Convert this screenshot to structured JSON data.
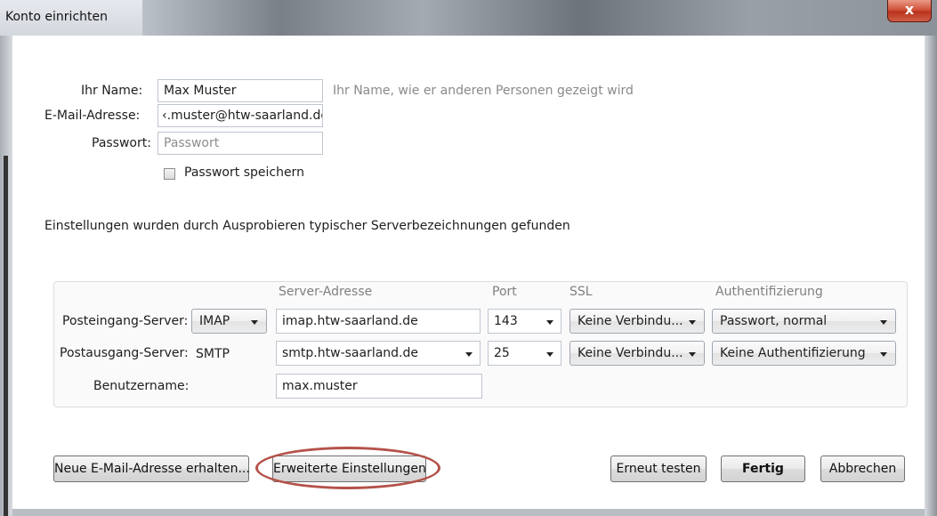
{
  "window": {
    "title": "Konto einrichten",
    "close_glyph": "x"
  },
  "account": {
    "name_label": "Ihr Name:",
    "name_value": "Max Muster",
    "name_hint": "Ihr Name, wie er anderen Personen gezeigt wird",
    "email_label": "E-Mail-Adresse:",
    "email_value": "‹.muster@htw-saarland.de",
    "password_label": "Passwort:",
    "password_placeholder": "Passwort",
    "save_password_label": "Passwort speichern",
    "save_password_checked": false
  },
  "status_message": "Einstellungen wurden durch Ausprobieren typischer Serverbezeichnungen gefunden",
  "server": {
    "columns": {
      "address": "Server-Adresse",
      "port": "Port",
      "ssl": "SSL",
      "auth": "Authentifizierung"
    },
    "incoming": {
      "label": "Posteingang-Server:",
      "protocol": "IMAP",
      "address": "imap.htw-saarland.de",
      "port": "143",
      "ssl": "Keine Verbindu...",
      "auth": "Passwort, normal"
    },
    "outgoing": {
      "label": "Postausgang-Server:",
      "protocol": "SMTP",
      "address": "smtp.htw-saarland.de",
      "port": "25",
      "ssl": "Keine Verbindu...",
      "auth": "Keine Authentifizierung"
    },
    "username_label": "Benutzername:",
    "username_value": "max.muster"
  },
  "buttons": {
    "new_address": "Neue E-Mail-Adresse erhalten...",
    "advanced": "Erweiterte Einstellungen",
    "retest": "Erneut testen",
    "done": "Fertig",
    "cancel": "Abbrechen"
  },
  "annotation": {
    "highlight_color": "#b4524a"
  }
}
